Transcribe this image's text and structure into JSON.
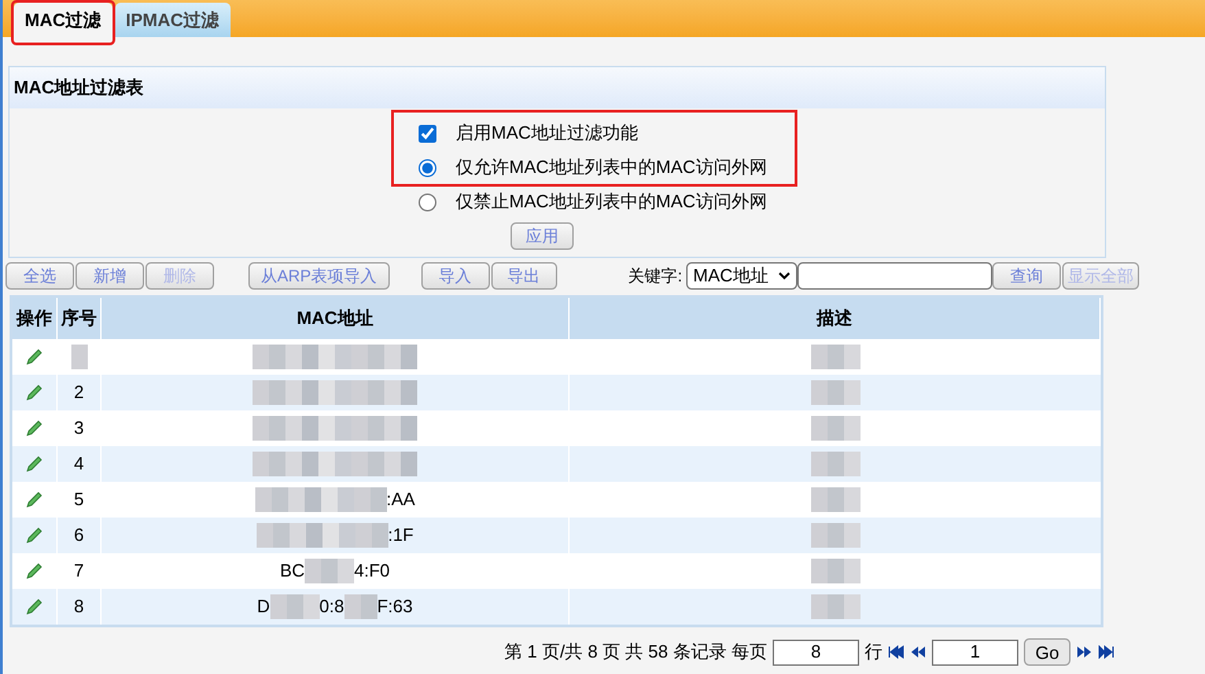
{
  "tabs": [
    {
      "label": "MAC过滤",
      "selected": true,
      "highlighted": true
    },
    {
      "label": "IPMAC过滤",
      "selected": false,
      "highlighted": false
    }
  ],
  "panel": {
    "title": "MAC地址过滤表",
    "highlighted": true,
    "options": [
      {
        "kind": "checkbox",
        "label": "启用MAC地址过滤功能",
        "checked": true
      },
      {
        "kind": "radio",
        "label": "仅允许MAC地址列表中的MAC访问外网",
        "selected": true
      },
      {
        "kind": "radio",
        "label": "仅禁止MAC地址列表中的MAC访问外网",
        "selected": false
      }
    ],
    "apply_button": "应用"
  },
  "toolbar": {
    "buttons": [
      {
        "label": "全选",
        "disabled": false
      },
      {
        "label": "新增",
        "disabled": false
      },
      {
        "label": "删除",
        "disabled": true
      }
    ],
    "import_arp": "从ARP表项导入",
    "import": "导入",
    "export": "导出",
    "keyword_label": "关键字:",
    "keyword_select": "MAC地址",
    "search": "查询",
    "show_all": {
      "label": "显示全部",
      "disabled": true
    }
  },
  "table": {
    "columns": [
      "操作",
      "序号",
      "MAC地址",
      "描述"
    ],
    "rows": [
      {
        "index": "",
        "mac": []
      },
      {
        "index": "2",
        "mac": []
      },
      {
        "index": "3",
        "mac": []
      },
      {
        "index": "4",
        "mac": []
      },
      {
        "index": "5",
        "mac": [
          ":AA"
        ]
      },
      {
        "index": "6",
        "mac": [
          ":1F"
        ]
      },
      {
        "index": "7",
        "mac": [
          "BC",
          "4:F0"
        ]
      },
      {
        "index": "8",
        "mac": [
          "D",
          "0:8",
          "F:63"
        ]
      }
    ]
  },
  "pagination": {
    "summary": "第 1 页/共 8 页 共 58 条记录 每页",
    "per_page": "8",
    "rows_label": "行",
    "page": "1",
    "go": "Go"
  }
}
